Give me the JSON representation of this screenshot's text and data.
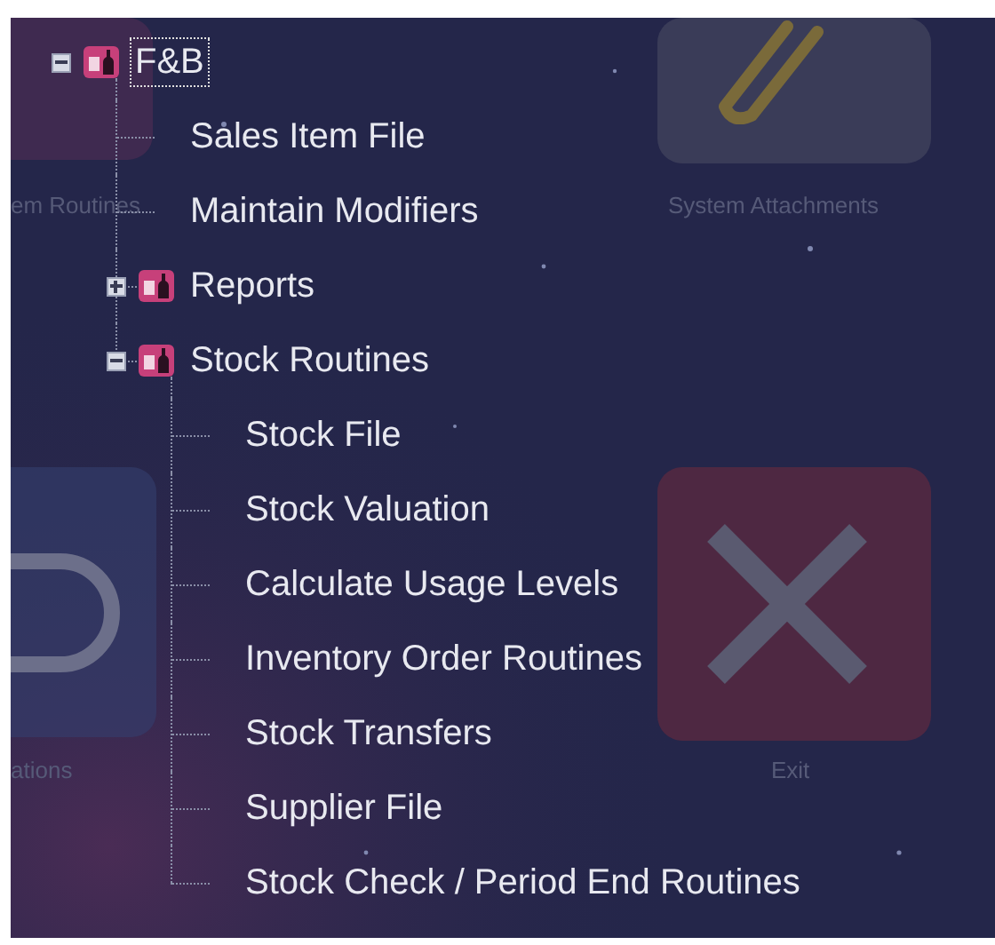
{
  "background_tiles": [
    {
      "kind": "routines",
      "label": "em Routines"
    },
    {
      "kind": "attachments",
      "label": "System Attachments"
    },
    {
      "kind": "link",
      "label": "ations"
    },
    {
      "kind": "exit",
      "label": "Exit"
    }
  ],
  "tree": [
    {
      "label": "F&B",
      "kind": "folder",
      "expanded": true,
      "selected": true,
      "children": [
        {
          "label": "Sales Item File",
          "kind": "item",
          "selected": false
        },
        {
          "label": "Maintain Modifiers",
          "kind": "item",
          "selected": false
        },
        {
          "label": "Reports",
          "kind": "folder",
          "expanded": false,
          "selected": false
        },
        {
          "label": "Stock Routines",
          "kind": "folder",
          "expanded": true,
          "selected": false,
          "children": [
            {
              "label": "Stock File",
              "kind": "item",
              "selected": false
            },
            {
              "label": "Stock Valuation",
              "kind": "item",
              "selected": false
            },
            {
              "label": "Calculate Usage Levels",
              "kind": "item",
              "selected": false
            },
            {
              "label": "Inventory Order Routines",
              "kind": "item",
              "selected": false
            },
            {
              "label": "Stock Transfers",
              "kind": "item",
              "selected": false
            },
            {
              "label": "Supplier File",
              "kind": "item",
              "selected": false
            },
            {
              "label": "Stock Check / Period End Routines",
              "kind": "item",
              "selected": false
            }
          ]
        }
      ]
    }
  ]
}
